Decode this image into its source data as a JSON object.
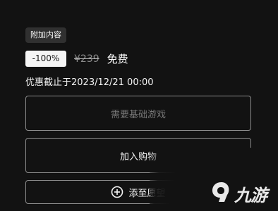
{
  "product": {
    "tag": "附加内容",
    "discount": "-100%",
    "original_price": "¥239",
    "final_price": "免费",
    "sale_ends": "优惠截止于2023/12/21 00:00"
  },
  "actions": {
    "requires_base_game": "需要基础游戏",
    "add_to_cart": "加入购物",
    "add_to_wishlist": "添至愿望"
  },
  "watermark": {
    "text": "九游",
    "logo_icon": "jiuyou-logo-icon"
  }
}
